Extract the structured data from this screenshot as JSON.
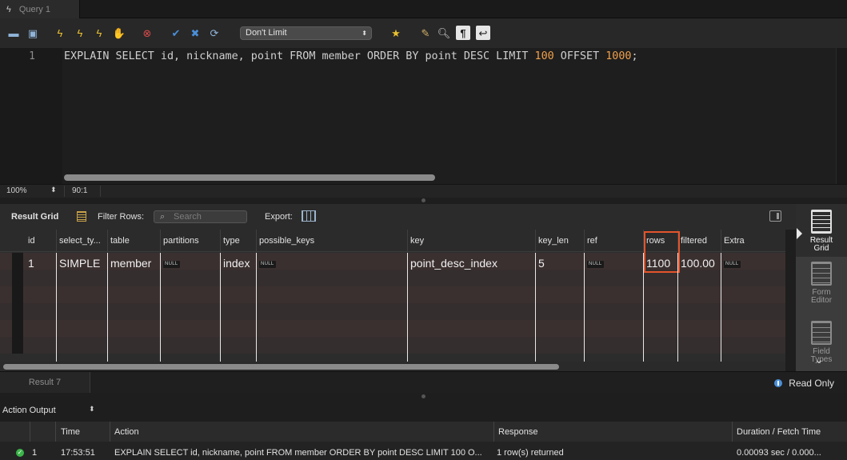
{
  "tab": {
    "title": "Query 1"
  },
  "toolbar": {
    "limit_select": "Don't Limit",
    "colors": {
      "execute": "#e8c030",
      "stop": "#c0392b",
      "ok": "#4a8fd8"
    }
  },
  "editor": {
    "line_number": "1",
    "sql_part1": "EXPLAIN SELECT id, nickname, point FROM member ORDER BY point DESC LIMIT ",
    "limit_value": "100",
    "sql_part2": " OFFSET ",
    "offset_value": "1000",
    "sql_end": ";",
    "zoom": "100%",
    "cursor_position": "90:1"
  },
  "result_toolbar": {
    "title": "Result Grid",
    "filter_label": "Filter Rows:",
    "search_placeholder": "Search",
    "export_label": "Export:"
  },
  "grid": {
    "columns": [
      "id",
      "select_ty...",
      "table",
      "partitions",
      "type",
      "possible_keys",
      "key",
      "key_len",
      "ref",
      "rows",
      "filtered",
      "Extra"
    ],
    "rows": [
      [
        "1",
        "SIMPLE",
        "member",
        "NULL",
        "index",
        "NULL",
        "point_desc_index",
        "5",
        "NULL",
        "1100",
        "100.00",
        "NULL"
      ]
    ],
    "highlight_color": "#e4542c"
  },
  "right_panel": {
    "result_grid": "Result Grid",
    "form_editor": "Form Editor",
    "field_types": "Field Types"
  },
  "result_tabs": {
    "active": "Result 7",
    "read_only": "Read Only"
  },
  "action_output": {
    "title": "Action Output",
    "columns": [
      "Time",
      "Action",
      "Response",
      "Duration / Fetch Time"
    ],
    "rows": [
      {
        "num": "1",
        "time": "17:53:51",
        "action": "EXPLAIN SELECT id, nickname, point FROM member ORDER BY point DESC LIMIT 100 O...",
        "response": "1 row(s) returned",
        "duration": "0.00093 sec / 0.000..."
      }
    ]
  }
}
